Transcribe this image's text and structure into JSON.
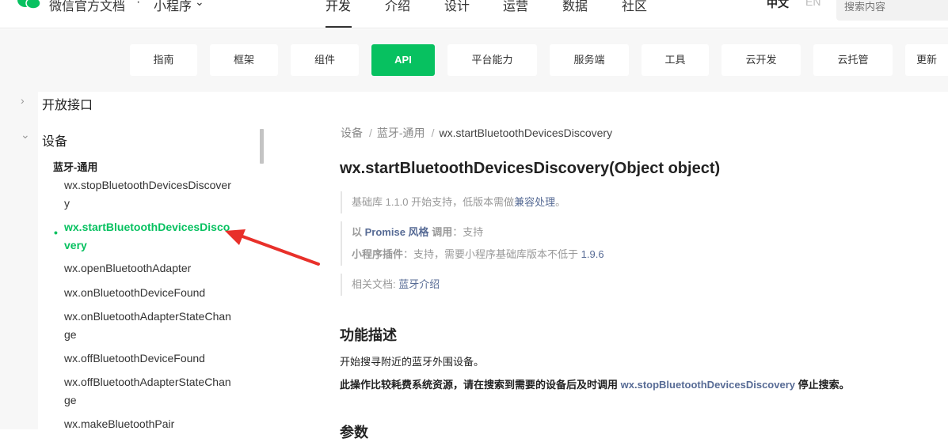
{
  "topbar": {
    "brand": "微信官方文档",
    "brand_dot": "·",
    "brand_sub": "小程序",
    "brand_chevron": "⌄",
    "nav": [
      "开发",
      "介绍",
      "设计",
      "运营",
      "数据",
      "社区"
    ],
    "lang_zh": "中文",
    "lang_en": "EN",
    "search_placeholder": "搜索内容"
  },
  "subnav": {
    "tabs": [
      "指南",
      "框架",
      "组件",
      "API",
      "平台能力",
      "服务端",
      "工具",
      "云开发",
      "云托管",
      "更新"
    ],
    "active": "API"
  },
  "sidebar": {
    "chevron_right": "›",
    "chevron_down": "⌄",
    "group1": "开放接口",
    "group2": "设备",
    "sub_group": "蓝牙-通用",
    "bullet": "•",
    "items": [
      "wx.stopBluetoothDevicesDiscovery",
      "wx.startBluetoothDevicesDiscovery",
      "wx.openBluetoothAdapter",
      "wx.onBluetoothDeviceFound",
      "wx.onBluetoothAdapterStateChange",
      "wx.offBluetoothDeviceFound",
      "wx.offBluetoothAdapterStateChange",
      "wx.makeBluetoothPair"
    ]
  },
  "main": {
    "breadcrumb": [
      "设备",
      "蓝牙-通用",
      "wx.startBluetoothDevicesDiscovery"
    ],
    "breadcrumb_sep": "/",
    "title": "wx.startBluetoothDevicesDiscovery(Object object)",
    "support_text": "基础库 1.1.0 开始支持，低版本需做",
    "support_link": "兼容处理",
    "support_end": "。",
    "promise_prefix": "以",
    "promise_label": "Promise 风格",
    "promise_call": "调用",
    "promise_value": "：支持",
    "plugin_label": "小程序插件",
    "plugin_value": "：支持，需要小程序基础库版本不低于",
    "plugin_version": "1.9.6",
    "related_label": "相关文档:",
    "related_link": "蓝牙介绍",
    "section_title": "功能描述",
    "desc1": "开始搜寻附近的蓝牙外围设备。",
    "desc2_prefix": "此操作比较耗费系统资源，请在搜索到需要的设备后及时调用",
    "desc2_link": "wx.stopBluetoothDevicesDiscovery",
    "desc2_suffix": "停止搜索。",
    "params_title": "参数"
  },
  "colors": {
    "brand_green": "#07c160",
    "link": "#576b95",
    "annotation_red": "#e8302a"
  }
}
